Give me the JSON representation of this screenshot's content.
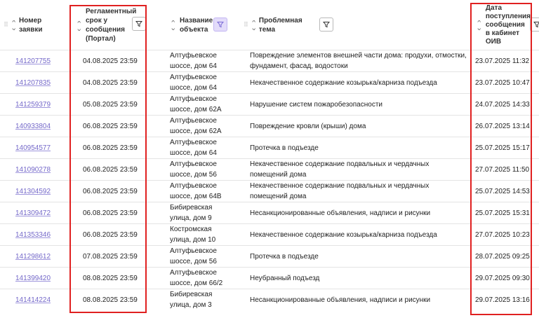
{
  "columns": {
    "number": "Номер\nзаявки",
    "deadline": "Регламентный\nсрок у\nсообщения\n(Портал)",
    "object": "Название\nобъекта",
    "topic": "Проблемная тема",
    "received": "Дата\nпоступления\nсообщения\nв кабинет\nОИВ"
  },
  "highlight_color": "#e02020",
  "filter_active_color": "#e3dcfa",
  "rows": [
    {
      "number": "141207755",
      "deadline": "04.08.2025 23:59",
      "object": "Алтуфьевское\nшоссе, дом 64",
      "topic": "Повреждение элементов внешней части дома: продухи, отмостки,\nфундамент, фасад, водостоки",
      "received": "23.07.2025 11:32"
    },
    {
      "number": "141207835",
      "deadline": "04.08.2025 23:59",
      "object": "Алтуфьевское\nшоссе, дом 64",
      "topic": "Некачественное содержание козырька/карниза подъезда",
      "received": "23.07.2025 10:47"
    },
    {
      "number": "141259379",
      "deadline": "05.08.2025 23:59",
      "object": "Алтуфьевское\nшоссе, дом 62А",
      "topic": "Нарушение систем пожаробезопасности",
      "received": "24.07.2025 14:33"
    },
    {
      "number": "140933804",
      "deadline": "06.08.2025 23:59",
      "object": "Алтуфьевское\nшоссе, дом 62А",
      "topic": "Повреждение кровли (крыши) дома",
      "received": "26.07.2025 13:14"
    },
    {
      "number": "140954577",
      "deadline": "06.08.2025 23:59",
      "object": "Алтуфьевское\nшоссе, дом 64",
      "topic": "Протечка в подъезде",
      "received": "25.07.2025 15:17"
    },
    {
      "number": "141090278",
      "deadline": "06.08.2025 23:59",
      "object": "Алтуфьевское\nшоссе, дом 56",
      "topic": "Некачественное содержание подвальных и чердачных\nпомещений дома",
      "received": "27.07.2025 11:50"
    },
    {
      "number": "141304592",
      "deadline": "06.08.2025 23:59",
      "object": "Алтуфьевское\nшоссе, дом 64В",
      "topic": "Некачественное содержание подвальных и чердачных\nпомещений дома",
      "received": "25.07.2025 14:53"
    },
    {
      "number": "141309472",
      "deadline": "06.08.2025 23:59",
      "object": "Бибиревская\nулица, дом 9",
      "topic": "Несанкционированные объявления, надписи и рисунки",
      "received": "25.07.2025 15:31"
    },
    {
      "number": "141353346",
      "deadline": "06.08.2025 23:59",
      "object": "Костромская\nулица, дом 10",
      "topic": "Некачественное содержание козырька/карниза подъезда",
      "received": "27.07.2025 10:23"
    },
    {
      "number": "141298612",
      "deadline": "07.08.2025 23:59",
      "object": "Алтуфьевское\nшоссе, дом 56",
      "topic": "Протечка в подъезде",
      "received": "28.07.2025 09:25"
    },
    {
      "number": "141399420",
      "deadline": "08.08.2025 23:59",
      "object": "Алтуфьевское\nшоссе, дом 66/2",
      "topic": "Неубранный подъезд",
      "received": "29.07.2025 09:30"
    },
    {
      "number": "141414224",
      "deadline": "08.08.2025 23:59",
      "object": "Бибиревская\nулица, дом 3",
      "topic": "Несанкционированные объявления, надписи и рисунки",
      "received": "29.07.2025 13:16"
    }
  ]
}
